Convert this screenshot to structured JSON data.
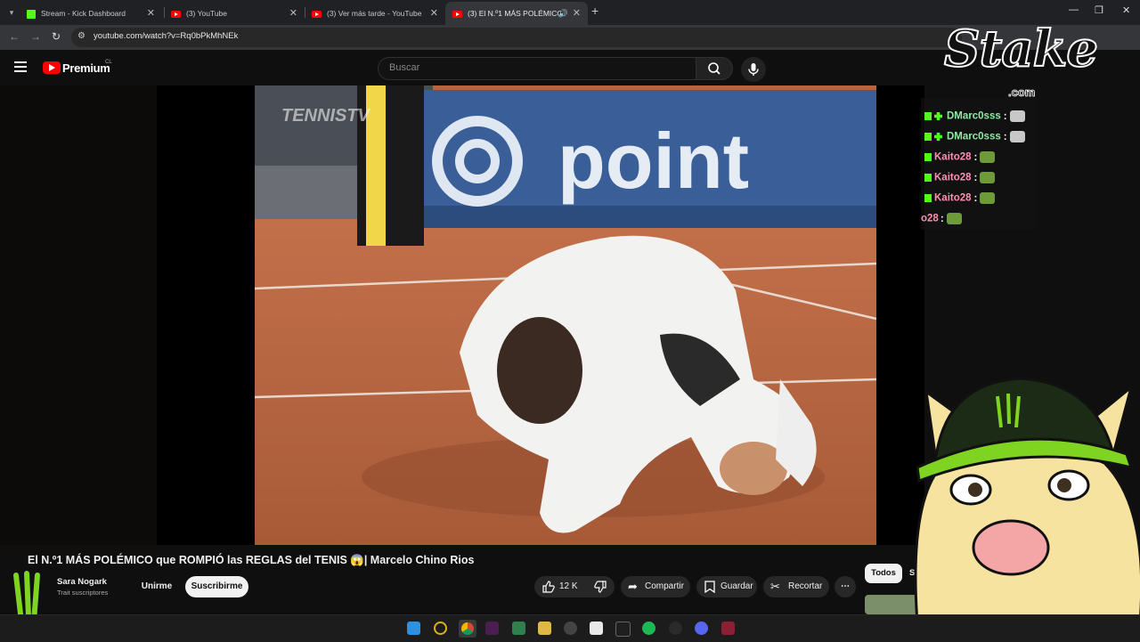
{
  "browser": {
    "tabs": [
      {
        "title": "Stream - Kick Dashboard",
        "favicon": "kick-icon"
      },
      {
        "title": "(3) YouTube",
        "favicon": "youtube-icon"
      },
      {
        "title": "(3) Ver más tarde - YouTube",
        "favicon": "youtube-icon"
      },
      {
        "title": "(3) El N.º1 MÁS POLÉMICO",
        "favicon": "youtube-icon",
        "active": true
      }
    ],
    "url": "youtube.com/watch?v=Rq0bPkMhNEk"
  },
  "youtube": {
    "logo_text": "Premium",
    "region": "CL",
    "search_placeholder": "Buscar"
  },
  "video": {
    "title": "El N.º1 MÁS POLÉMICO que ROMPIÓ las REGLAS del TENIS 😱| Marcelo Chino Rios",
    "watermark": "TENNISTV",
    "banner_text": "point",
    "channel": {
      "name": "Sara Nogark",
      "subscribers": "Trait suscriptores"
    },
    "join_label": "Unirme",
    "subscribe_label": "Suscribirme",
    "likes": "12 K",
    "share_label": "Compartir",
    "save_label": "Guardar",
    "clip_label": "Recortar",
    "more_label": "⋯"
  },
  "sidebar_chips": {
    "all": "Todos",
    "next": "S"
  },
  "stream_overlay": {
    "sponsor": "Stake",
    "sponsor_domain": ".com",
    "chat": [
      {
        "user": "DMarc0sss",
        "color": "#8fe9a5",
        "badges": 2
      },
      {
        "user": "DMarc0sss",
        "color": "#8fe9a5",
        "badges": 2
      },
      {
        "user": "Kaito28",
        "color": "#ff8fb1",
        "badges": 1
      },
      {
        "user": "Kaito28",
        "color": "#ff8fb1",
        "badges": 1
      },
      {
        "user": "Kaito28",
        "color": "#ff8fb1",
        "badges": 1
      },
      {
        "user": "o28",
        "color": "#ff8fb1",
        "badges": 0
      }
    ],
    "separator": ":"
  },
  "colors": {
    "youtube_red": "#ff0000",
    "kick_green": "#53fc18",
    "monster_green": "#7fd321"
  }
}
